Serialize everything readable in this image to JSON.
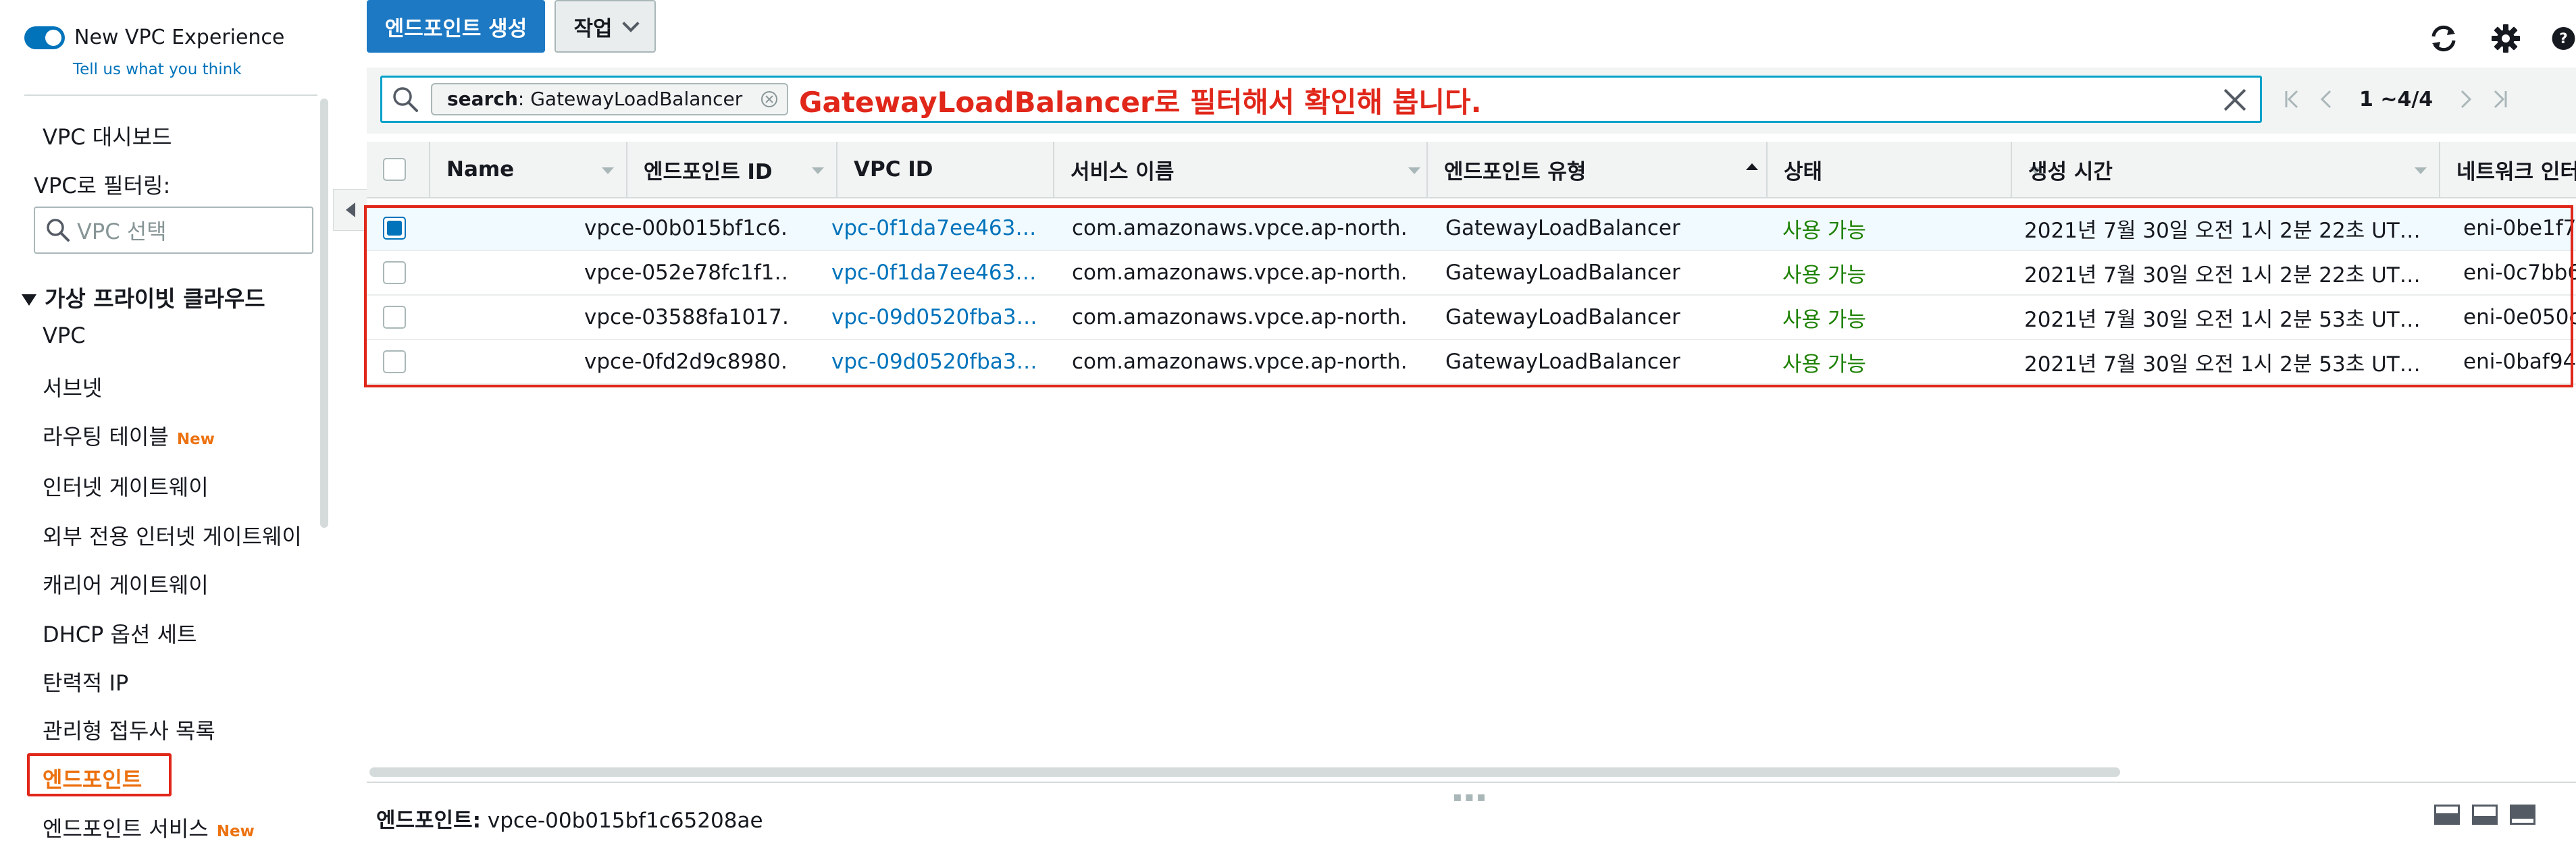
{
  "experience": {
    "toggle_label": "New VPC Experience",
    "feedback_link": "Tell us what you think"
  },
  "sidebar": {
    "dashboard": "VPC 대시보드",
    "filter_label": "VPC로 필터링:",
    "filter_placeholder": "VPC 선택",
    "section": "가상 프라이빗 클라우드",
    "items": [
      {
        "label": "VPC",
        "badge": ""
      },
      {
        "label": "서브넷",
        "badge": ""
      },
      {
        "label": "라우팅 테이블",
        "badge": "New"
      },
      {
        "label": "인터넷 게이트웨이",
        "badge": ""
      },
      {
        "label": "외부 전용 인터넷 게이트웨이",
        "badge": ""
      },
      {
        "label": "캐리어 게이트웨이",
        "badge": ""
      },
      {
        "label": "DHCP 옵션 세트",
        "badge": ""
      },
      {
        "label": "탄력적 IP",
        "badge": ""
      },
      {
        "label": "관리형 접두사 목록",
        "badge": ""
      },
      {
        "label": "엔드포인트",
        "badge": ""
      },
      {
        "label": "엔드포인트 서비스",
        "badge": "New"
      }
    ],
    "active_item": "엔드포인트"
  },
  "toolbar": {
    "create_button": "엔드포인트 생성",
    "actions_button": "작업"
  },
  "search": {
    "token_key": "search",
    "token_value": ": GatewayLoadBalancer",
    "annotation": "GatewayLoadBalancer로 필터해서 확인해 봅니다."
  },
  "pager": {
    "count": "1 ~4/4"
  },
  "table": {
    "headers": [
      "Name",
      "엔드포인트 ID",
      "VPC ID",
      "서비스 이름",
      "엔드포인트 유형",
      "상태",
      "생성 시간",
      "네트워크 인터"
    ],
    "rows": [
      {
        "name": "",
        "endpoint_id": "vpce-00b015bf1c6…",
        "vpc_id": "vpc-0f1da7ee463…",
        "service": "com.amazonaws.vpce.ap-north…",
        "type": "GatewayLoadBalancer",
        "status": "사용 가능",
        "created": "2021년 7월 30일 오전 1시 2분 22초 UT…",
        "eni": "eni-0be1f7",
        "selected": true
      },
      {
        "name": "",
        "endpoint_id": "vpce-052e78fc1f1…",
        "vpc_id": "vpc-0f1da7ee463…",
        "service": "com.amazonaws.vpce.ap-north…",
        "type": "GatewayLoadBalancer",
        "status": "사용 가능",
        "created": "2021년 7월 30일 오전 1시 2분 22초 UT…",
        "eni": "eni-0c7bb6",
        "selected": false
      },
      {
        "name": "",
        "endpoint_id": "vpce-03588fa1017…",
        "vpc_id": "vpc-09d0520fba3…",
        "service": "com.amazonaws.vpce.ap-north…",
        "type": "GatewayLoadBalancer",
        "status": "사용 가능",
        "created": "2021년 7월 30일 오전 1시 2분 53초 UT…",
        "eni": "eni-0e050c",
        "selected": false
      },
      {
        "name": "",
        "endpoint_id": "vpce-0fd2d9c8980…",
        "vpc_id": "vpc-09d0520fba3…",
        "service": "com.amazonaws.vpce.ap-north…",
        "type": "GatewayLoadBalancer",
        "status": "사용 가능",
        "created": "2021년 7월 30일 오전 1시 2분 53초 UT…",
        "eni": "eni-0baf94",
        "selected": false
      }
    ]
  },
  "detail": {
    "label": "엔드포인트:",
    "value": "vpce-00b015bf1c65208ae"
  },
  "colors": {
    "primary": "#1d79c4",
    "link": "#0073bb",
    "available": "#1d8102",
    "highlight": "#e0271a",
    "active_nav": "#ec7211"
  }
}
